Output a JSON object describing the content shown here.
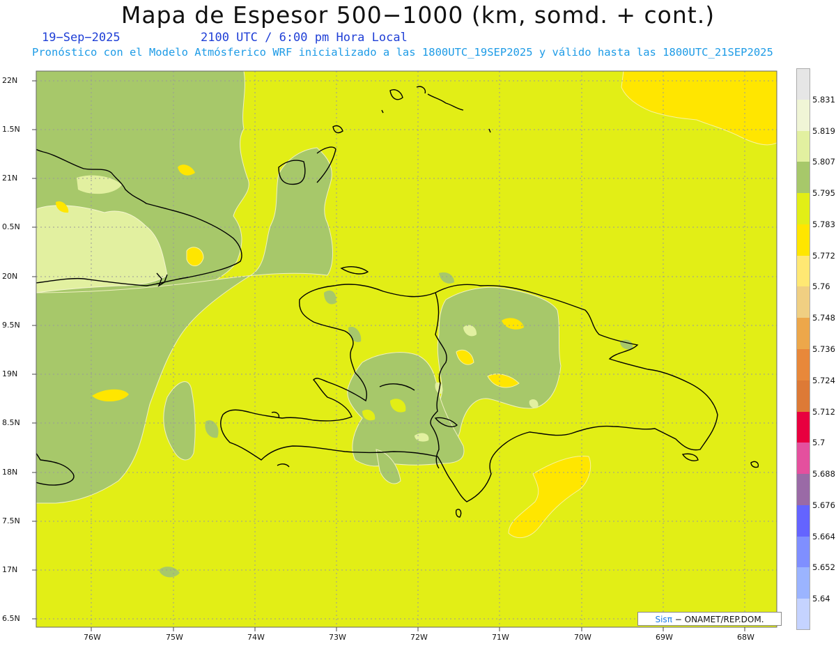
{
  "title": "Mapa de Espesor 500−1000 (km, somd. + cont.)",
  "date_label": "19−Sep−2025",
  "time_label": "2100 UTC / 6:00 pm Hora Local",
  "forecast_label": "Pronóstico con el Modelo Atmósferico WRF inicializado a las 1800UTC_19SEP2025 y válido hasta las  1800UTC_21SEP2025",
  "credit": {
    "brand": "Sisπ",
    "text": "− ONAMET/REP.DOM."
  },
  "lat_labels": [
    "22N",
    "1.5N",
    "21N",
    "0.5N",
    "20N",
    "9.5N",
    "19N",
    "8.5N",
    "18N",
    "7.5N",
    "17N",
    "6.5N"
  ],
  "lon_labels": [
    "76W",
    "75W",
    "74W",
    "73W",
    "72W",
    "71W",
    "70W",
    "69W",
    "68W"
  ],
  "colorbar": {
    "labels": [
      "5.831",
      "5.819",
      "5.807",
      "5.795",
      "5.783",
      "5.772",
      "5.76",
      "5.748",
      "5.736",
      "5.724",
      "5.712",
      "5.7",
      "5.688",
      "5.676",
      "5.664",
      "5.652",
      "5.64"
    ],
    "colors": [
      "#e6e6e6",
      "#f0f5d6",
      "#e2f0a0",
      "#a7c86a",
      "#e2ee16",
      "#ffe600",
      "#ffe873",
      "#f0cf82",
      "#eda74a",
      "#e8883a",
      "#dd7a36",
      "#e8003f",
      "#e4509e",
      "#9a6aa6",
      "#6464ff",
      "#7f8fff",
      "#9bb4ff",
      "#c5d3ff"
    ]
  },
  "colors": {
    "base_field": "#e2ee16",
    "green_field": "#a7c86a",
    "light_field": "#e2f0a0",
    "yellow_field": "#ffe600",
    "coast": "#000000",
    "grid": "#9a9a9a"
  }
}
